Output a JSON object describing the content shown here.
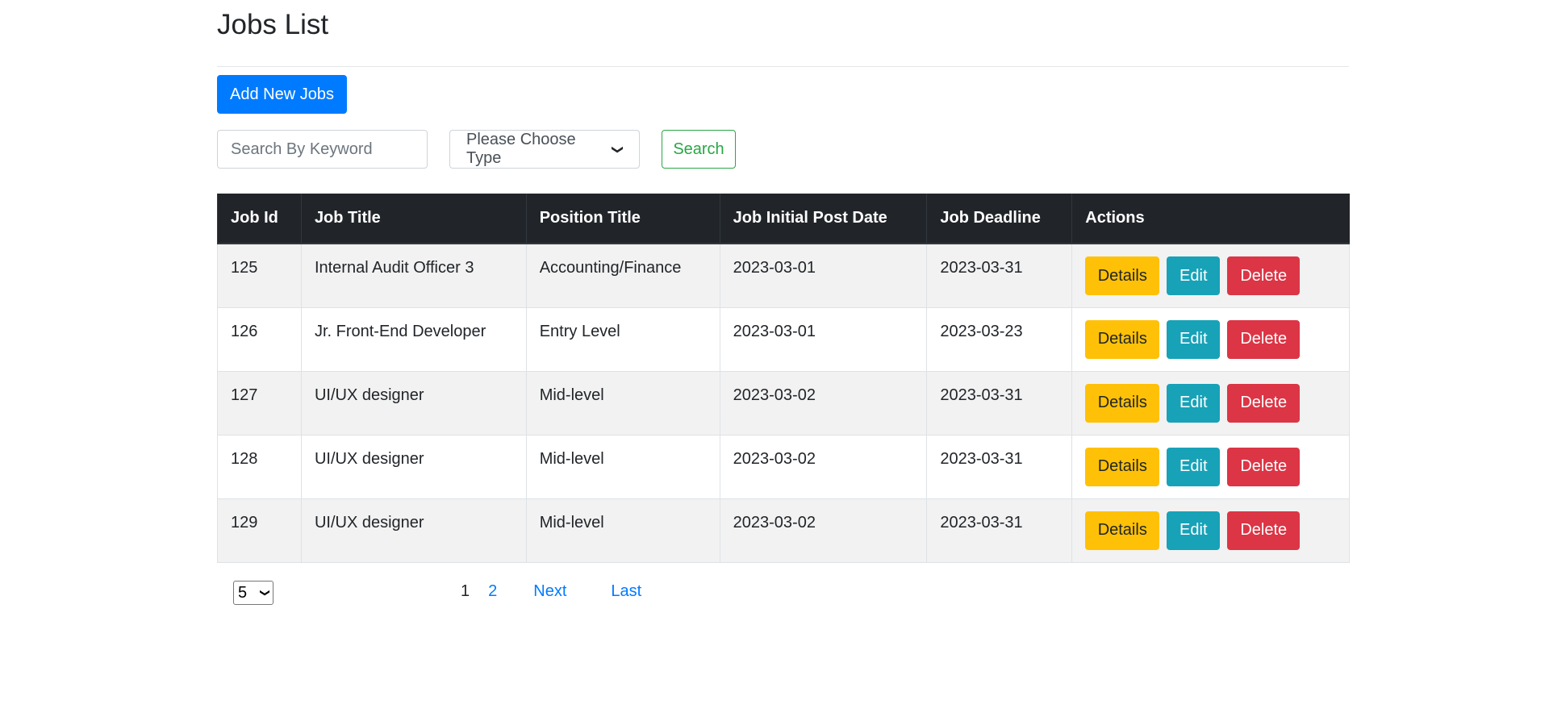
{
  "page": {
    "title": "Jobs List"
  },
  "toolbar": {
    "add_label": "Add New Jobs"
  },
  "search": {
    "placeholder": "Search By Keyword",
    "type_select_value": "Please Choose Type",
    "button_label": "Search"
  },
  "table": {
    "headers": [
      "Job Id",
      "Job Title",
      "Position Title",
      "Job Initial Post Date",
      "Job Deadline",
      "Actions"
    ],
    "rows": [
      {
        "id": "125",
        "title": "Internal Audit Officer 3",
        "position": "Accounting/Finance",
        "post_date": "2023-03-01",
        "deadline": "2023-03-31"
      },
      {
        "id": "126",
        "title": "Jr. Front-End Developer",
        "position": "Entry Level",
        "post_date": "2023-03-01",
        "deadline": "2023-03-23"
      },
      {
        "id": "127",
        "title": "UI/UX designer",
        "position": "Mid-level",
        "post_date": "2023-03-02",
        "deadline": "2023-03-31"
      },
      {
        "id": "128",
        "title": "UI/UX designer",
        "position": "Mid-level",
        "post_date": "2023-03-02",
        "deadline": "2023-03-31"
      },
      {
        "id": "129",
        "title": "UI/UX designer",
        "position": "Mid-level",
        "post_date": "2023-03-02",
        "deadline": "2023-03-31"
      }
    ],
    "actions": {
      "details": "Details",
      "edit": "Edit",
      "delete": "Delete"
    }
  },
  "pagination": {
    "page_size": "5",
    "pages": [
      "1",
      "2"
    ],
    "current_page": "1",
    "next_label": "Next",
    "last_label": "Last"
  },
  "colors": {
    "primary": "#007bff",
    "success": "#28a745",
    "warning": "#ffc107",
    "info": "#17a2b8",
    "danger": "#dc3545",
    "header_bg": "#212529"
  },
  "icons": {
    "select_caret": "chevron-down-icon"
  }
}
